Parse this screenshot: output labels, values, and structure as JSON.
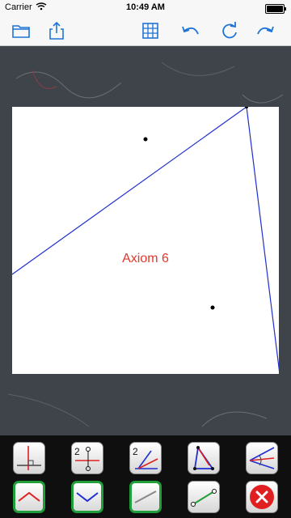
{
  "status": {
    "carrier": "Carrier",
    "time": "10:49 AM"
  },
  "navbar": {
    "icons": [
      "folder-icon",
      "share-icon",
      "grid-icon",
      "undo-icon",
      "refresh-icon",
      "redo-icon"
    ]
  },
  "paper": {
    "axis_label": "Axiom 6"
  },
  "toolbar": {
    "row1": [
      "axiom-perpendicular-icon",
      "axiom-two-points-icon",
      "axiom-two-angle-icon",
      "axiom-triangle-icon",
      "axiom-bisector-icon"
    ],
    "row2": [
      "fold-valley-icon",
      "fold-mountain-icon",
      "crease-line-icon",
      "point-line-icon",
      "close-icon"
    ]
  },
  "colors": {
    "fold_line": "#1f2fd0",
    "label": "#e0392b",
    "accent": "#1e73d6",
    "toggle_border": "#1f9e3a"
  }
}
